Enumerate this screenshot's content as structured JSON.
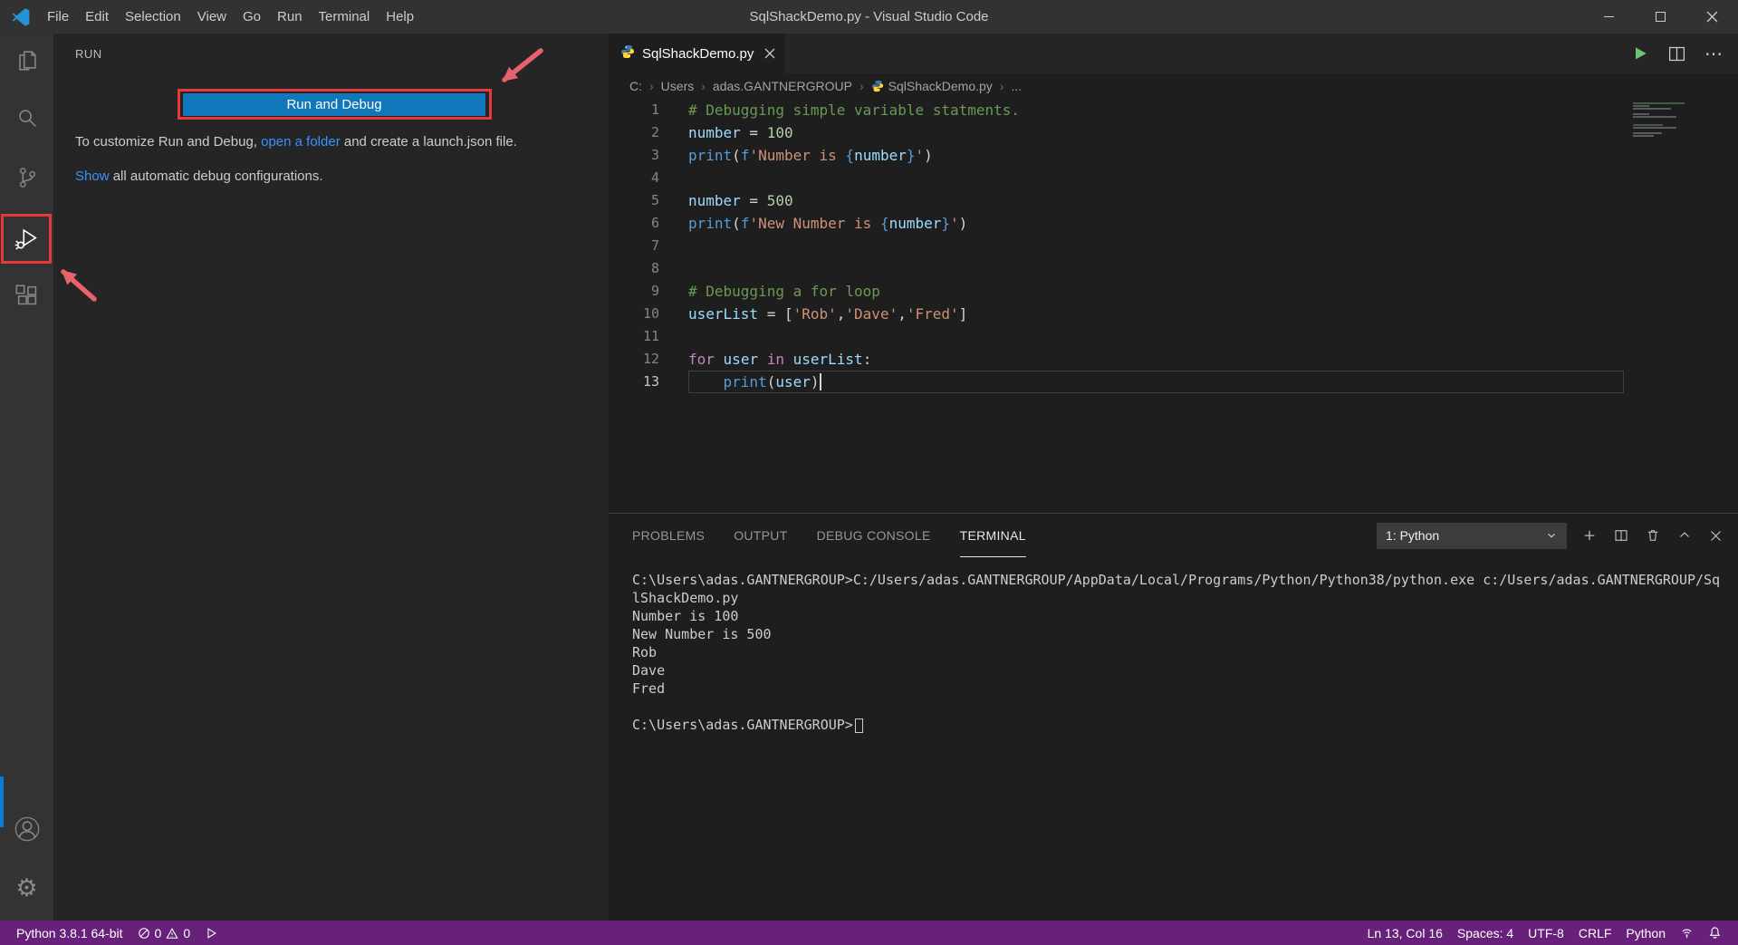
{
  "colors": {
    "annotation_red": "#e5393e",
    "annotation_arrow": "#e8626e",
    "button_blue": "#1177bb",
    "statusbar_purple": "#68217a"
  },
  "titlebar": {
    "menus": [
      "File",
      "Edit",
      "Selection",
      "View",
      "Go",
      "Run",
      "Terminal",
      "Help"
    ],
    "title": "SqlShackDemo.py - Visual Studio Code"
  },
  "activity_bar": {
    "items": [
      "explorer",
      "search",
      "source-control",
      "run-and-debug",
      "extensions"
    ],
    "bottom_items": [
      "account",
      "settings"
    ]
  },
  "sidebar": {
    "header": "RUN",
    "run_button_label": "Run and Debug",
    "hint_prefix": "To customize Run and Debug, ",
    "open_folder_link": "open a folder",
    "hint_suffix": " and create a launch.json file.",
    "show_link": "Show",
    "show_suffix": " all automatic debug configurations."
  },
  "editor": {
    "tab_label": "SqlShackDemo.py",
    "breadcrumbs": [
      "C:",
      "Users",
      "adas.GANTNERGROUP",
      "SqlShackDemo.py",
      "..."
    ],
    "lines": [
      {
        "n": 1,
        "tokens": [
          {
            "t": "# Debugging simple variable statments.",
            "c": "comment"
          }
        ]
      },
      {
        "n": 2,
        "tokens": [
          {
            "t": "number",
            "c": "var"
          },
          {
            "t": " = ",
            "c": "plain"
          },
          {
            "t": "100",
            "c": "num"
          }
        ]
      },
      {
        "n": 3,
        "tokens": [
          {
            "t": "print",
            "c": "kw"
          },
          {
            "t": "(",
            "c": "plain"
          },
          {
            "t": "f",
            "c": "kw"
          },
          {
            "t": "'Number is ",
            "c": "str"
          },
          {
            "t": "{",
            "c": "kw"
          },
          {
            "t": "number",
            "c": "var"
          },
          {
            "t": "}",
            "c": "kw"
          },
          {
            "t": "'",
            "c": "str"
          },
          {
            "t": ")",
            "c": "plain"
          }
        ]
      },
      {
        "n": 4,
        "tokens": []
      },
      {
        "n": 5,
        "tokens": [
          {
            "t": "number",
            "c": "var"
          },
          {
            "t": " = ",
            "c": "plain"
          },
          {
            "t": "500",
            "c": "num"
          }
        ]
      },
      {
        "n": 6,
        "tokens": [
          {
            "t": "print",
            "c": "kw"
          },
          {
            "t": "(",
            "c": "plain"
          },
          {
            "t": "f",
            "c": "kw"
          },
          {
            "t": "'New Number is ",
            "c": "str"
          },
          {
            "t": "{",
            "c": "kw"
          },
          {
            "t": "number",
            "c": "var"
          },
          {
            "t": "}",
            "c": "kw"
          },
          {
            "t": "'",
            "c": "str"
          },
          {
            "t": ")",
            "c": "plain"
          }
        ]
      },
      {
        "n": 7,
        "tokens": []
      },
      {
        "n": 8,
        "tokens": []
      },
      {
        "n": 9,
        "tokens": [
          {
            "t": "# Debugging a for loop",
            "c": "comment"
          }
        ]
      },
      {
        "n": 10,
        "tokens": [
          {
            "t": "userList",
            "c": "var"
          },
          {
            "t": " = [",
            "c": "plain"
          },
          {
            "t": "'Rob'",
            "c": "str"
          },
          {
            "t": ",",
            "c": "plain"
          },
          {
            "t": "'Dave'",
            "c": "str"
          },
          {
            "t": ",",
            "c": "plain"
          },
          {
            "t": "'Fred'",
            "c": "str"
          },
          {
            "t": "]",
            "c": "plain"
          }
        ]
      },
      {
        "n": 11,
        "tokens": []
      },
      {
        "n": 12,
        "tokens": [
          {
            "t": "for",
            "c": "ctrl"
          },
          {
            "t": " ",
            "c": "plain"
          },
          {
            "t": "user",
            "c": "var"
          },
          {
            "t": " ",
            "c": "plain"
          },
          {
            "t": "in",
            "c": "ctrl"
          },
          {
            "t": " ",
            "c": "plain"
          },
          {
            "t": "userList",
            "c": "var"
          },
          {
            "t": ":",
            "c": "plain"
          }
        ]
      },
      {
        "n": 13,
        "current": true,
        "cursor": true,
        "tokens": [
          {
            "t": "    ",
            "c": "plain"
          },
          {
            "t": "print",
            "c": "kw"
          },
          {
            "t": "(",
            "c": "plain"
          },
          {
            "t": "user",
            "c": "var"
          },
          {
            "t": ")",
            "c": "plain"
          }
        ]
      }
    ]
  },
  "panel": {
    "tabs": [
      "PROBLEMS",
      "OUTPUT",
      "DEBUG CONSOLE",
      "TERMINAL"
    ],
    "active_tab": "TERMINAL",
    "dropdown_label": "1: Python",
    "terminal_lines": [
      {
        "text": "C:\\Users\\adas.GANTNERGROUP>C:/Users/adas.GANTNERGROUP/AppData/Local/Programs/Python/Python38/python.exe c:/Users/adas.GANTNERGROUP/Sq"
      },
      {
        "text": "lShackDemo.py"
      },
      {
        "text": "Number is 100"
      },
      {
        "text": "New Number is 500"
      },
      {
        "text": "Rob"
      },
      {
        "text": "Dave"
      },
      {
        "text": "Fred"
      },
      {
        "text": ""
      },
      {
        "text": "C:\\Users\\adas.GANTNERGROUP>",
        "cursor": true
      }
    ]
  },
  "status_bar": {
    "python_version": "Python 3.8.1 64-bit",
    "errors": "0",
    "warnings": "0",
    "cursor_position": "Ln 13, Col 16",
    "indentation": "Spaces: 4",
    "encoding": "UTF-8",
    "eol": "CRLF",
    "language": "Python"
  }
}
